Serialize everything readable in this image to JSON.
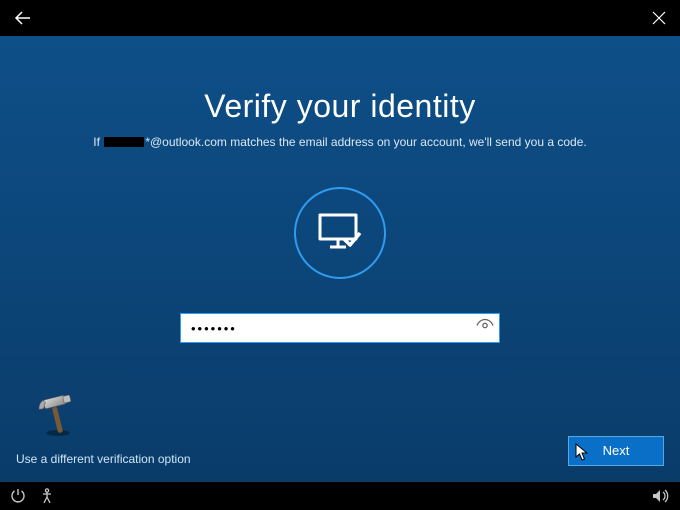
{
  "title": "Verify your identity",
  "subtitle_prefix": "If ",
  "email_domain": "*@outlook.com",
  "subtitle_suffix": " matches the email address on your account, we'll send you a code.",
  "input_value": "•••••••",
  "alt_option": "Use a different verification option",
  "next_label": "Next"
}
